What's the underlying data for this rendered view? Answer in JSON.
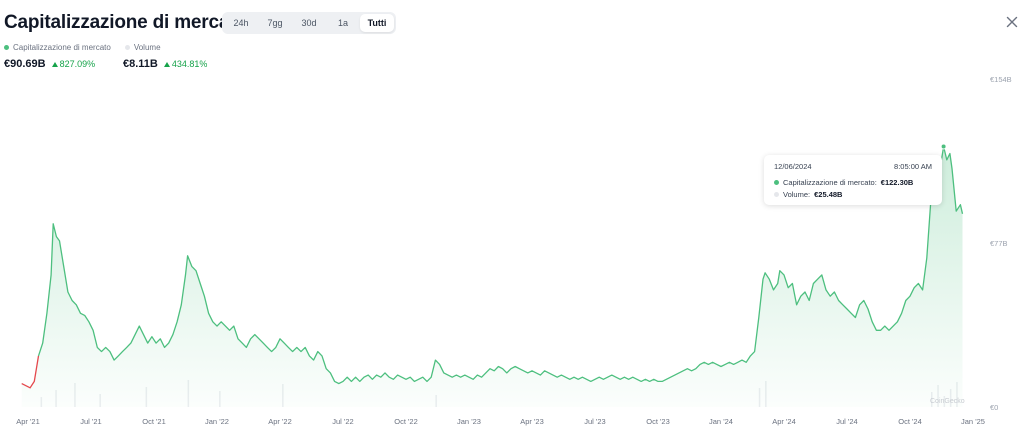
{
  "header": {
    "title": "Capitalizzazione di mercato",
    "close_icon": "close-icon"
  },
  "tabs": [
    {
      "label": "24h",
      "active": false
    },
    {
      "label": "7gg",
      "active": false
    },
    {
      "label": "30d",
      "active": false
    },
    {
      "label": "1a",
      "active": false
    },
    {
      "label": "Tutti",
      "active": true
    }
  ],
  "legend": [
    {
      "label": "Capitalizzazione di mercato",
      "color": "#4dbf7f"
    },
    {
      "label": "Volume",
      "color": "#e5e7eb"
    }
  ],
  "stats": {
    "market_cap": {
      "value": "€90.69B",
      "change": "827.09%"
    },
    "volume": {
      "value": "€8.11B",
      "change": "434.81%"
    }
  },
  "tooltip": {
    "date": "12/06/2024",
    "time": "8:05:00 AM",
    "market_cap_label": "Capitalizzazione di mercato:",
    "market_cap_value": "€122.30B",
    "volume_label": "Volume:",
    "volume_value": "€25.48B"
  },
  "watermark": "CoinGecko",
  "chart_data": {
    "type": "area",
    "title": "",
    "xlabel": "",
    "ylabel": "",
    "ylim": [
      0,
      154
    ],
    "y_ticks": [
      "€0",
      "€77B",
      "€154B"
    ],
    "y_tick_values": [
      0,
      77,
      154
    ],
    "x_ticks": [
      "Apr '21",
      "Jul '21",
      "Oct '21",
      "Jan '22",
      "Apr '22",
      "Jul '22",
      "Oct '22",
      "Jan '23",
      "Apr '23",
      "Jul '23",
      "Oct '23",
      "Jan '24",
      "Apr '24",
      "Jul '24",
      "Oct '24",
      "Jan '25"
    ],
    "x_tick_values": [
      0,
      3,
      6,
      9,
      12,
      15,
      18,
      21,
      24,
      27,
      30,
      33,
      36,
      39,
      42,
      45
    ],
    "x_unit": "months since Apr 2021",
    "grid": false,
    "colors": {
      "line": "#4dbf7f",
      "fill": "#4dbf7f",
      "start": "#e5484d",
      "volume": "#eceef1"
    },
    "series": [
      {
        "name": "Capitalizzazione di mercato",
        "points": [
          [
            -0.3,
            11
          ],
          [
            0.1,
            9
          ],
          [
            0.3,
            12
          ],
          [
            0.5,
            24
          ],
          [
            0.7,
            30
          ],
          [
            0.9,
            44
          ],
          [
            1.1,
            62
          ],
          [
            1.2,
            86
          ],
          [
            1.35,
            80
          ],
          [
            1.5,
            78
          ],
          [
            1.7,
            66
          ],
          [
            1.9,
            54
          ],
          [
            2.1,
            50
          ],
          [
            2.3,
            48
          ],
          [
            2.5,
            44
          ],
          [
            2.7,
            43
          ],
          [
            2.9,
            40
          ],
          [
            3.1,
            36
          ],
          [
            3.3,
            28
          ],
          [
            3.5,
            26
          ],
          [
            3.7,
            28
          ],
          [
            3.9,
            26
          ],
          [
            4.1,
            22
          ],
          [
            4.3,
            24
          ],
          [
            4.5,
            26
          ],
          [
            4.7,
            28
          ],
          [
            4.9,
            30
          ],
          [
            5.1,
            34
          ],
          [
            5.3,
            38
          ],
          [
            5.5,
            34
          ],
          [
            5.7,
            30
          ],
          [
            5.9,
            33
          ],
          [
            6.1,
            30
          ],
          [
            6.3,
            32
          ],
          [
            6.5,
            28
          ],
          [
            6.7,
            30
          ],
          [
            6.9,
            34
          ],
          [
            7.1,
            40
          ],
          [
            7.3,
            48
          ],
          [
            7.5,
            62
          ],
          [
            7.6,
            71
          ],
          [
            7.8,
            66
          ],
          [
            8.0,
            64
          ],
          [
            8.2,
            58
          ],
          [
            8.4,
            52
          ],
          [
            8.6,
            44
          ],
          [
            8.8,
            40
          ],
          [
            9.0,
            38
          ],
          [
            9.2,
            40
          ],
          [
            9.4,
            38
          ],
          [
            9.6,
            36
          ],
          [
            9.8,
            38
          ],
          [
            10.0,
            32
          ],
          [
            10.2,
            30
          ],
          [
            10.4,
            28
          ],
          [
            10.6,
            32
          ],
          [
            10.8,
            34
          ],
          [
            11.0,
            32
          ],
          [
            11.2,
            30
          ],
          [
            11.4,
            28
          ],
          [
            11.6,
            26
          ],
          [
            11.8,
            28
          ],
          [
            12.0,
            32
          ],
          [
            12.2,
            30
          ],
          [
            12.4,
            28
          ],
          [
            12.6,
            26
          ],
          [
            12.8,
            28
          ],
          [
            13.0,
            26
          ],
          [
            13.2,
            28
          ],
          [
            13.4,
            24
          ],
          [
            13.6,
            22
          ],
          [
            13.8,
            26
          ],
          [
            14.0,
            24
          ],
          [
            14.2,
            18
          ],
          [
            14.4,
            16
          ],
          [
            14.6,
            12
          ],
          [
            14.8,
            11
          ],
          [
            15.0,
            12
          ],
          [
            15.2,
            14
          ],
          [
            15.4,
            12
          ],
          [
            15.6,
            14
          ],
          [
            15.8,
            12
          ],
          [
            16.0,
            14
          ],
          [
            16.2,
            15
          ],
          [
            16.4,
            13
          ],
          [
            16.6,
            15
          ],
          [
            16.8,
            14
          ],
          [
            17.0,
            16
          ],
          [
            17.2,
            14
          ],
          [
            17.4,
            13
          ],
          [
            17.6,
            15
          ],
          [
            17.8,
            14
          ],
          [
            18.0,
            13
          ],
          [
            18.2,
            14
          ],
          [
            18.4,
            12
          ],
          [
            18.6,
            13
          ],
          [
            18.8,
            14
          ],
          [
            19.0,
            12
          ],
          [
            19.2,
            14
          ],
          [
            19.4,
            22
          ],
          [
            19.6,
            20
          ],
          [
            19.8,
            16
          ],
          [
            20.0,
            15
          ],
          [
            20.2,
            14
          ],
          [
            20.4,
            15
          ],
          [
            20.6,
            14
          ],
          [
            20.8,
            15
          ],
          [
            21.0,
            14
          ],
          [
            21.2,
            13
          ],
          [
            21.4,
            15
          ],
          [
            21.6,
            14
          ],
          [
            21.8,
            16
          ],
          [
            22.0,
            18
          ],
          [
            22.2,
            17
          ],
          [
            22.4,
            19
          ],
          [
            22.6,
            18
          ],
          [
            22.8,
            16
          ],
          [
            23.0,
            18
          ],
          [
            23.2,
            19
          ],
          [
            23.4,
            18
          ],
          [
            23.6,
            17
          ],
          [
            23.8,
            16
          ],
          [
            24.0,
            17
          ],
          [
            24.2,
            16
          ],
          [
            24.4,
            15
          ],
          [
            24.6,
            17
          ],
          [
            24.8,
            16
          ],
          [
            25.0,
            15
          ],
          [
            25.2,
            14
          ],
          [
            25.4,
            15
          ],
          [
            25.6,
            14
          ],
          [
            25.8,
            13
          ],
          [
            26.0,
            14
          ],
          [
            26.2,
            13
          ],
          [
            26.4,
            14
          ],
          [
            26.6,
            13
          ],
          [
            26.8,
            12
          ],
          [
            27.0,
            13
          ],
          [
            27.2,
            14
          ],
          [
            27.4,
            13
          ],
          [
            27.6,
            14
          ],
          [
            27.8,
            15
          ],
          [
            28.0,
            14
          ],
          [
            28.2,
            13
          ],
          [
            28.4,
            14
          ],
          [
            28.6,
            13
          ],
          [
            28.8,
            14
          ],
          [
            29.0,
            13
          ],
          [
            29.2,
            12
          ],
          [
            29.4,
            13
          ],
          [
            29.6,
            12
          ],
          [
            29.8,
            13
          ],
          [
            30.0,
            12
          ],
          [
            30.2,
            12
          ],
          [
            30.4,
            13
          ],
          [
            30.6,
            14
          ],
          [
            30.8,
            15
          ],
          [
            31.0,
            16
          ],
          [
            31.2,
            17
          ],
          [
            31.4,
            18
          ],
          [
            31.6,
            17
          ],
          [
            31.8,
            18
          ],
          [
            32.0,
            20
          ],
          [
            32.2,
            21
          ],
          [
            32.4,
            20
          ],
          [
            32.6,
            21
          ],
          [
            32.8,
            20
          ],
          [
            33.0,
            19
          ],
          [
            33.2,
            20
          ],
          [
            33.4,
            21
          ],
          [
            33.6,
            20
          ],
          [
            33.8,
            21
          ],
          [
            34.0,
            22
          ],
          [
            34.2,
            21
          ],
          [
            34.4,
            24
          ],
          [
            34.6,
            26
          ],
          [
            34.8,
            42
          ],
          [
            35.0,
            60
          ],
          [
            35.1,
            63
          ],
          [
            35.3,
            60
          ],
          [
            35.5,
            55
          ],
          [
            35.7,
            58
          ],
          [
            35.8,
            64
          ],
          [
            36.0,
            62
          ],
          [
            36.2,
            56
          ],
          [
            36.4,
            58
          ],
          [
            36.6,
            48
          ],
          [
            36.8,
            52
          ],
          [
            37.0,
            54
          ],
          [
            37.2,
            50
          ],
          [
            37.4,
            58
          ],
          [
            37.6,
            60
          ],
          [
            37.8,
            62
          ],
          [
            38.0,
            55
          ],
          [
            38.2,
            52
          ],
          [
            38.4,
            54
          ],
          [
            38.6,
            50
          ],
          [
            38.8,
            48
          ],
          [
            39.0,
            46
          ],
          [
            39.2,
            44
          ],
          [
            39.4,
            42
          ],
          [
            39.6,
            48
          ],
          [
            39.8,
            50
          ],
          [
            40.0,
            46
          ],
          [
            40.2,
            40
          ],
          [
            40.4,
            36
          ],
          [
            40.6,
            36
          ],
          [
            40.8,
            38
          ],
          [
            41.0,
            36
          ],
          [
            41.2,
            38
          ],
          [
            41.4,
            40
          ],
          [
            41.6,
            44
          ],
          [
            41.8,
            50
          ],
          [
            42.0,
            52
          ],
          [
            42.2,
            56
          ],
          [
            42.4,
            58
          ],
          [
            42.6,
            55
          ],
          [
            42.8,
            70
          ],
          [
            43.0,
            98
          ],
          [
            43.1,
            104
          ],
          [
            43.3,
            110
          ],
          [
            43.5,
            116
          ],
          [
            43.6,
            122.3
          ],
          [
            43.75,
            116
          ],
          [
            43.9,
            119
          ],
          [
            44.0,
            112
          ],
          [
            44.2,
            92
          ],
          [
            44.4,
            95
          ],
          [
            44.5,
            90.69
          ]
        ]
      }
    ]
  }
}
